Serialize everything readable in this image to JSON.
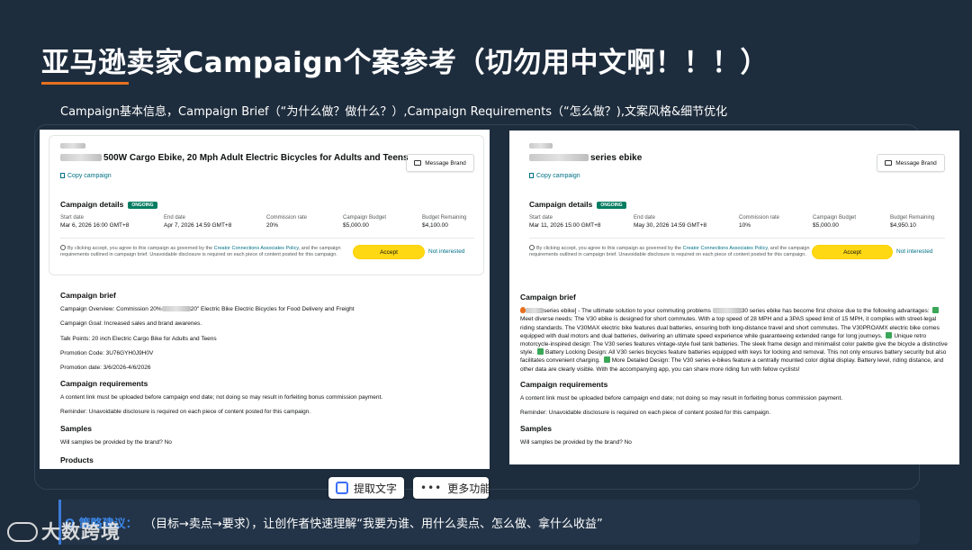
{
  "slide": {
    "title": "亚马逊卖家Campaign个案参考（切勿用中文啊！！！）",
    "subtitle": "Campaign基本信息，Campaign Brief（“为什么做？做什么？）,Campaign Requirements（“怎么做？),文案风格&细节优化"
  },
  "left_campaign": {
    "title": "500W Cargo Ebike, 20 Mph Adult Electric Bicycles for Adults and Teens",
    "copy_link": "Copy campaign",
    "message_button": "Message Brand",
    "details_heading": "Campaign details",
    "status_badge": "ONGOING",
    "metrics": [
      {
        "label": "Start date",
        "value": "Mar 6, 2026 16:00 GMT+8"
      },
      {
        "label": "End date",
        "value": "Apr 7, 2026 14:59 GMT+8"
      },
      {
        "label": "Commission rate",
        "value": "20%"
      },
      {
        "label": "Campaign Budget",
        "value": "$5,000.00"
      },
      {
        "label": "Budget Remaining",
        "value": "$4,100.00"
      }
    ],
    "disclaimer_pre": "By clicking accept, you agree to this campaign as governed by the ",
    "disclaimer_link": "Creator Connections Associates Policy",
    "disclaimer_post": ", and the campaign requirements outlined in campaign brief. Unavoidable disclosure is required on each piece of content posted for this campaign.",
    "accept_button": "Accept",
    "not_interested": "Not interested",
    "brief_heading": "Campaign brief",
    "brief_overview_pre": "Campaign Overview: Commission 20%",
    "brief_overview_post": "20\" Electric Bike Electric Bicycles for Food Delivery and Freight",
    "brief_goal": "Campaign Goal: Increased sales and brand awarenes.",
    "brief_talk": "Talk Points: 20 inch Electric Cargo Bike for Adults and Teens",
    "brief_code": "Promotion Code: 3U76GYH0J9H0V",
    "brief_date": "Promotion date: 3/6/2026-4/6/2026",
    "requirements_heading": "Campaign requirements",
    "req_1": "A content link must be uploaded before campaign end date; not doing so may result in forfeiting bonus commission payment.",
    "req_2": "Reminder: Unavoidable disclosure is required on each piece of content posted for this campaign.",
    "samples_heading": "Samples",
    "samples_text": "Will samples be provided by the brand? No",
    "products_heading": "Products"
  },
  "right_campaign": {
    "title": "series ebike",
    "copy_link": "Copy campaign",
    "message_button": "Message Brand",
    "details_heading": "Campaign details",
    "status_badge": "ONGOING",
    "metrics": [
      {
        "label": "Start date",
        "value": "Mar 11, 2026 15:00 GMT+8"
      },
      {
        "label": "End date",
        "value": "May 30, 2026 14:59 GMT+8"
      },
      {
        "label": "Commission rate",
        "value": "10%"
      },
      {
        "label": "Campaign Budget",
        "value": "$5,000.00"
      },
      {
        "label": "Budget Remaining",
        "value": "$4,950.10"
      }
    ],
    "disclaimer_pre": "By clicking accept, you agree to this campaign as governed by the ",
    "disclaimer_link": "Creator Connections Associates Policy",
    "disclaimer_post": ", and the campaign requirements outlined in campaign brief. Unavoidable disclosure is required on each piece of content posted for this campaign.",
    "accept_button": "Accept",
    "not_interested": "Not interested",
    "brief_heading": "Campaign brief",
    "brief_p1": "series ebike] - The ultimate solution to your commuting problems",
    "brief_p1b": "30 series ebike has become first choice due to the following advantages:",
    "brief_p2": "Meet diverse needs: The V30 ebike is designed for short commutes. With a top speed of 28 MPH and a 3PAS speed limit of 15 MPH, it complies with street-legal riding standards. The V30MAX electric bike features dual batteries, ensuring both long-distance travel and short commutes. The V30PROAMX electric bike comes equipped with dual motors and dual batteries, delivering an ultimate speed experience while guaranteeing extended range for long journeys.",
    "brief_p3": "Unique retro motorcycle-inspired design: The V30 series features vintage-style fuel tank batteries. The sleek frame design and minimalist color palette give the bicycle a distinctive style.",
    "brief_p4": "Battery Locking Design: All V30 series bicycles feature batteries equipped with keys for locking and removal. This not only ensures battery security but also facilitates convenient charging.",
    "brief_p5": "More Detailed Design: The V30 series e-bikes feature a centrally mounted color digital display. Battery level, riding distance, and other data are clearly visible. With the accompanying app, you can share more riding fun with fellow cyclists!",
    "requirements_heading": "Campaign requirements",
    "req_1": "A content link must be uploaded before campaign end date; not doing so may result in forfeiting bonus commission payment.",
    "req_2": "Reminder: Unavoidable disclosure is required on each piece of content posted for this campaign.",
    "samples_heading": "Samples",
    "samples_text": "Will samples be provided by the brand? No"
  },
  "toolbar": {
    "extract_text": "提取文字",
    "more_functions": "更多功能"
  },
  "strategy": {
    "label": "Q 策略建议：",
    "text": "（目标→卖点→要求），让创作者快速理解“我要为谁、用什么卖点、怎么做、拿什么收益”"
  },
  "watermark": {
    "text": "大数跨境"
  },
  "colors": {
    "background": "#1e2d3d",
    "accent_orange": "#e8701f",
    "amazon_yellow": "#ffd814",
    "link_teal": "#007185",
    "ongoing_green": "#067d62"
  }
}
